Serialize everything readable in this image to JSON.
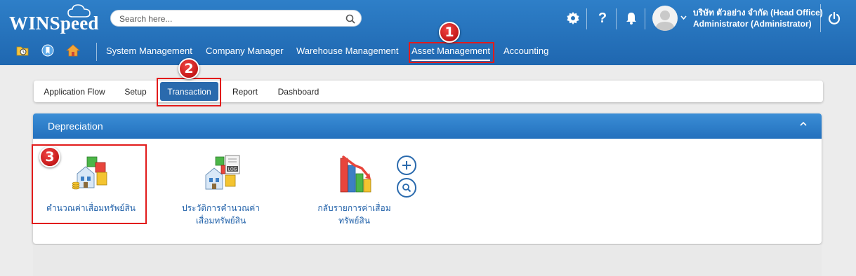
{
  "app": {
    "logo_text": "WINSpeed",
    "search_placeholder": "Search here...",
    "company": "บริษัท ตัวอย่าง จำกัด (Head Office)",
    "user": "Administrator (Administrator)"
  },
  "top_icons": [
    "gear-icon",
    "question-icon",
    "bell-icon",
    "avatar",
    "chevron-down-icon",
    "power-icon"
  ],
  "nav_icons": [
    "folder-clock-icon",
    "bookmark-icon",
    "home-icon"
  ],
  "menu": {
    "items": [
      {
        "label": "System Management"
      },
      {
        "label": "Company Manager"
      },
      {
        "label": "Warehouse Management"
      },
      {
        "label": "Asset Management",
        "active": true
      },
      {
        "label": "Accounting"
      }
    ]
  },
  "tabs": {
    "items": [
      {
        "label": "Application Flow"
      },
      {
        "label": "Setup"
      },
      {
        "label": "Transaction",
        "active": true
      },
      {
        "label": "Report"
      },
      {
        "label": "Dashboard"
      }
    ]
  },
  "panel": {
    "title": "Depreciation",
    "tiles": [
      {
        "label": "คำนวณค่าเสื่อมทรัพย์สิน",
        "icon": "asset-blocks-icon"
      },
      {
        "label_line1": "ประวัติการคำนวณค่า",
        "label_line2": "เสื่อมทรัพย์สิน",
        "icon": "asset-log-icon",
        "icon_tag": "LOG"
      },
      {
        "label_line1": "กลับรายการค่าเสื่อม",
        "label_line2": "ทรัพย์สิน",
        "icon": "bar-chart-down-icon"
      }
    ],
    "actions": [
      "add-icon",
      "search-icon"
    ]
  },
  "annotations": {
    "step1": "1",
    "step2": "2",
    "step3": "3"
  },
  "colors": {
    "header": "#2573bb",
    "accent": "#2a6aad",
    "annotation_red": "#e21b1b",
    "link_blue": "#1e5fa8"
  }
}
